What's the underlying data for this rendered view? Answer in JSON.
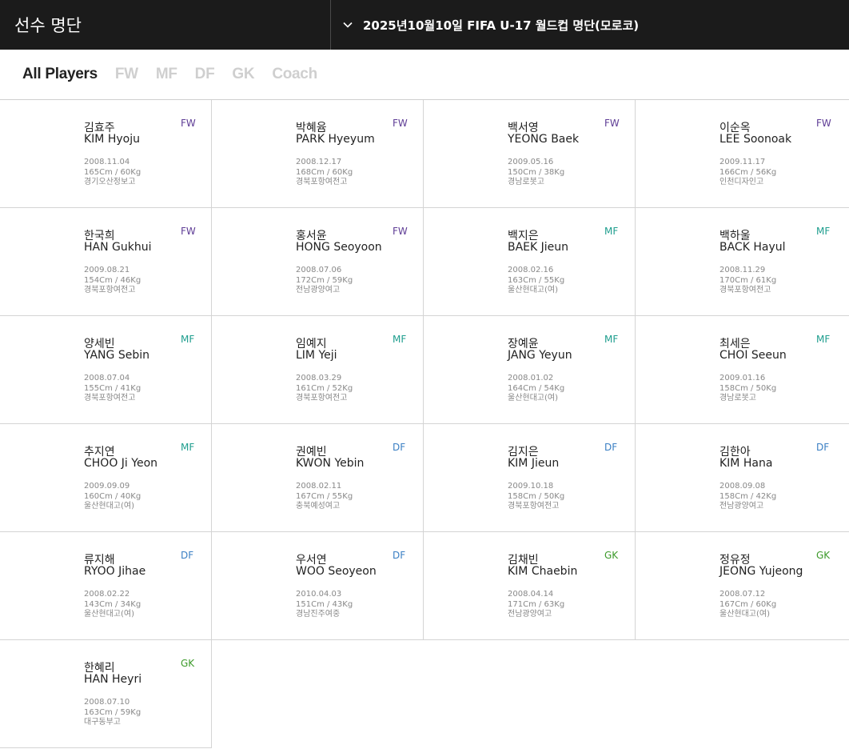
{
  "header": {
    "title": "선수 명단",
    "selector_label": "2025년10월10일 FIFA U-17 월드컵 명단(모로코)"
  },
  "filters": [
    "All Players",
    "FW",
    "MF",
    "DF",
    "GK",
    "Coach"
  ],
  "active_filter": "All Players",
  "colors": {
    "FW": "#5e3c95",
    "MF": "#1e9e8e",
    "DF": "#3a7fc4",
    "GK": "#3c9a2a",
    "header_bg": "#1b1b1b"
  },
  "players": [
    {
      "kname": "김효주",
      "ename": "KIM Hyoju",
      "pos": "FW",
      "birth": "2008.11.04",
      "body": "165Cm / 60Kg",
      "team": "경기오산정보고"
    },
    {
      "kname": "박혜윰",
      "ename": "PARK Hyeyum",
      "pos": "FW",
      "birth": "2008.12.17",
      "body": "168Cm / 60Kg",
      "team": "경북포항여전고"
    },
    {
      "kname": "백서영",
      "ename": "YEONG Baek",
      "pos": "FW",
      "birth": "2009.05.16",
      "body": "150Cm / 38Kg",
      "team": "경남로봇고"
    },
    {
      "kname": "이순옥",
      "ename": "LEE Soonoak",
      "pos": "FW",
      "birth": "2009.11.17",
      "body": "166Cm / 56Kg",
      "team": "인천디자인고"
    },
    {
      "kname": "한국희",
      "ename": "HAN Gukhui",
      "pos": "FW",
      "birth": "2009.08.21",
      "body": "154Cm / 46Kg",
      "team": "경북포항여전고"
    },
    {
      "kname": "홍서윤",
      "ename": "HONG Seoyoon",
      "pos": "FW",
      "birth": "2008.07.06",
      "body": "172Cm / 59Kg",
      "team": "전남광양여고"
    },
    {
      "kname": "백지은",
      "ename": "BAEK Jieun",
      "pos": "MF",
      "birth": "2008.02.16",
      "body": "163Cm / 55Kg",
      "team": "울산현대고(여)"
    },
    {
      "kname": "백하울",
      "ename": "BACK Hayul",
      "pos": "MF",
      "birth": "2008.11.29",
      "body": "170Cm / 61Kg",
      "team": "경북포항여전고"
    },
    {
      "kname": "양세빈",
      "ename": "YANG Sebin",
      "pos": "MF",
      "birth": "2008.07.04",
      "body": "155Cm / 41Kg",
      "team": "경북포항여전고"
    },
    {
      "kname": "임예지",
      "ename": "LIM Yeji",
      "pos": "MF",
      "birth": "2008.03.29",
      "body": "161Cm / 52Kg",
      "team": "경북포항여전고"
    },
    {
      "kname": "장예윤",
      "ename": "JANG Yeyun",
      "pos": "MF",
      "birth": "2008.01.02",
      "body": "164Cm / 54Kg",
      "team": "울산현대고(여)"
    },
    {
      "kname": "최세은",
      "ename": "CHOI Seeun",
      "pos": "MF",
      "birth": "2009.01.16",
      "body": "158Cm / 50Kg",
      "team": "경남로봇고"
    },
    {
      "kname": "추지연",
      "ename": "CHOO Ji Yeon",
      "pos": "MF",
      "birth": "2009.09.09",
      "body": "160Cm / 40Kg",
      "team": "울산현대고(여)"
    },
    {
      "kname": "권예빈",
      "ename": "KWON Yebin",
      "pos": "DF",
      "birth": "2008.02.11",
      "body": "167Cm / 55Kg",
      "team": "충북예성여고"
    },
    {
      "kname": "김지은",
      "ename": "KIM Jieun",
      "pos": "DF",
      "birth": "2009.10.18",
      "body": "158Cm / 50Kg",
      "team": "경북포항여전고"
    },
    {
      "kname": "김한아",
      "ename": "KIM Hana",
      "pos": "DF",
      "birth": "2008.09.08",
      "body": "158Cm / 42Kg",
      "team": "전남광양여고"
    },
    {
      "kname": "류지해",
      "ename": "RYOO Jihae",
      "pos": "DF",
      "birth": "2008.02.22",
      "body": "143Cm / 34Kg",
      "team": "울산현대고(여)"
    },
    {
      "kname": "우서연",
      "ename": "WOO Seoyeon",
      "pos": "DF",
      "birth": "2010.04.03",
      "body": "151Cm / 43Kg",
      "team": "경남진주여중"
    },
    {
      "kname": "김채빈",
      "ename": "KIM Chaebin",
      "pos": "GK",
      "birth": "2008.04.14",
      "body": "171Cm / 63Kg",
      "team": "전남광양여고"
    },
    {
      "kname": "정유정",
      "ename": "JEONG Yujeong",
      "pos": "GK",
      "birth": "2008.07.12",
      "body": "167Cm / 60Kg",
      "team": "울산현대고(여)"
    },
    {
      "kname": "한혜리",
      "ename": "HAN Heyri",
      "pos": "GK",
      "birth": "2008.07.10",
      "body": "163Cm / 59Kg",
      "team": "대구동부고"
    }
  ]
}
